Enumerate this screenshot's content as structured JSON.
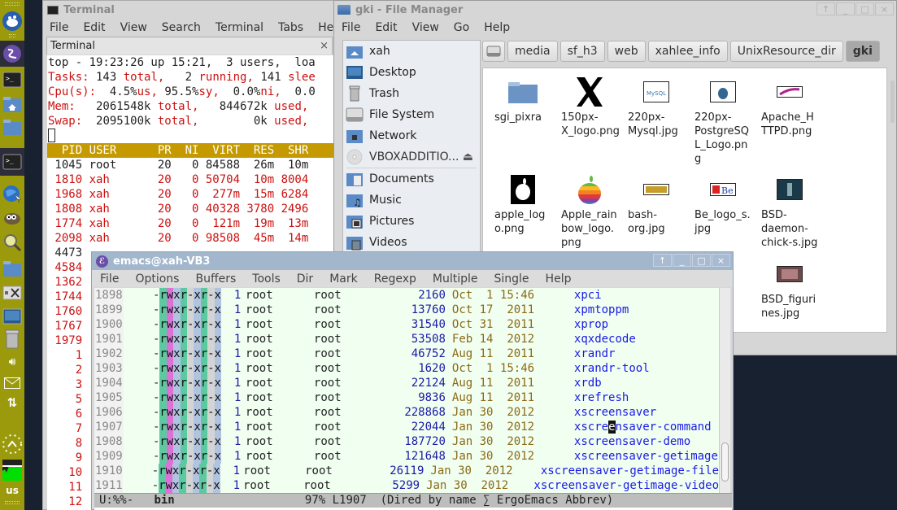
{
  "dock": {
    "icons": [
      "xfce-logo-icon",
      "emacs-icon",
      "terminal-icon",
      "home-folder-icon",
      "folder-icon",
      "terminal-icon",
      "web-browser-icon",
      "gimp-icon",
      "search-icon",
      "folder-icon",
      "settings-icon",
      "desktop-icon",
      "trash-icon",
      "volume-icon",
      "mail-icon",
      "network-icon",
      "clock-icon",
      "cpu-graph-icon"
    ],
    "keyboard_layout": "us"
  },
  "terminal": {
    "title": "Terminal",
    "menu": [
      "File",
      "Edit",
      "View",
      "Search",
      "Terminal",
      "Tabs",
      "Help"
    ],
    "tab_label": "Terminal",
    "tab_close": "×",
    "top_header": [
      [
        {
          "t": "top - 19:23:26 up 15:21,  3 users,  loa",
          "c": "k"
        }
      ],
      [
        {
          "t": "Tasks:",
          "c": "r"
        },
        {
          "t": " 143 ",
          "c": "k"
        },
        {
          "t": "total,",
          "c": "r"
        },
        {
          "t": "   2 ",
          "c": "k"
        },
        {
          "t": "running,",
          "c": "r"
        },
        {
          "t": " 141 ",
          "c": "k"
        },
        {
          "t": "slee",
          "c": "r"
        }
      ],
      [
        {
          "t": "Cpu(s):",
          "c": "r"
        },
        {
          "t": "  4.5%",
          "c": "k"
        },
        {
          "t": "us,",
          "c": "r"
        },
        {
          "t": " 95.5%",
          "c": "k"
        },
        {
          "t": "sy,",
          "c": "r"
        },
        {
          "t": "  0.0%",
          "c": "k"
        },
        {
          "t": "ni,",
          "c": "r"
        },
        {
          "t": "  0.0",
          "c": "k"
        }
      ],
      [
        {
          "t": "Mem:",
          "c": "r"
        },
        {
          "t": "   2061548k ",
          "c": "k"
        },
        {
          "t": "total,",
          "c": "r"
        },
        {
          "t": "   844672k ",
          "c": "k"
        },
        {
          "t": "used,",
          "c": "r"
        }
      ],
      [
        {
          "t": "Swap:",
          "c": "r"
        },
        {
          "t": "  2095100k ",
          "c": "k"
        },
        {
          "t": "total,",
          "c": "r"
        },
        {
          "t": "        0k ",
          "c": "k"
        },
        {
          "t": "used,",
          "c": "r"
        }
      ]
    ],
    "table_header": "  PID USER      PR  NI  VIRT  RES  SHR",
    "processes": [
      {
        "text": " 1045 root      20   0 84588  26m  10m",
        "highlight": false
      },
      {
        "text": " 1810 xah       20   0 50704  10m 8004",
        "highlight": true
      },
      {
        "text": " 1968 xah       20   0  277m  15m 6284",
        "highlight": true
      },
      {
        "text": " 1808 xah       20   0 40328 3780 2496",
        "highlight": true
      },
      {
        "text": " 1774 xah       20   0  121m  19m  13m",
        "highlight": true
      },
      {
        "text": " 2098 xah       20   0 98508  45m  14m",
        "highlight": true
      },
      {
        "text": " 4473",
        "highlight": false
      },
      {
        "text": " 4584",
        "highlight": true
      },
      {
        "text": " 1362",
        "highlight": true
      },
      {
        "text": " 1744",
        "highlight": true
      },
      {
        "text": " 1760",
        "highlight": true
      },
      {
        "text": " 1767",
        "highlight": true
      },
      {
        "text": " 1979",
        "highlight": true
      },
      {
        "text": "    1",
        "highlight": true
      },
      {
        "text": "    2",
        "highlight": true
      },
      {
        "text": "    3",
        "highlight": true
      },
      {
        "text": "    5",
        "highlight": true
      },
      {
        "text": "    6",
        "highlight": true
      },
      {
        "text": "    7",
        "highlight": true
      },
      {
        "text": "    8",
        "highlight": true
      },
      {
        "text": "    9",
        "highlight": true
      },
      {
        "text": "   10",
        "highlight": true
      },
      {
        "text": "   11",
        "highlight": true
      },
      {
        "text": "   12",
        "highlight": true
      }
    ]
  },
  "file_manager": {
    "title": "gki - File Manager",
    "menu": [
      "File",
      "Edit",
      "View",
      "Go",
      "Help"
    ],
    "window_buttons": [
      "↑",
      "_",
      "□",
      "×"
    ],
    "places": [
      {
        "label": "xah",
        "icon": "home-icon"
      },
      {
        "label": "Desktop",
        "icon": "desktop-icon"
      },
      {
        "label": "Trash",
        "icon": "trash-icon"
      },
      {
        "label": "File System",
        "icon": "drive-icon"
      },
      {
        "label": "Network",
        "icon": "network-icon"
      },
      {
        "label": "VBOXADDITIO...",
        "icon": "cdrom-icon",
        "eject": "⏏"
      },
      {
        "label": "Documents",
        "icon": "documents-folder-icon"
      },
      {
        "label": "Music",
        "icon": "music-folder-icon"
      },
      {
        "label": "Pictures",
        "icon": "pictures-folder-icon"
      },
      {
        "label": "Videos",
        "icon": "videos-folder-icon"
      }
    ],
    "path": [
      "media",
      "sf_h3",
      "web",
      "xahlee_info",
      "UnixResource_dir",
      "gki"
    ],
    "files": [
      {
        "name": "sgi_pixra",
        "kind": "folder"
      },
      {
        "name": "150px-\nX_logo.png",
        "kind": "x-logo"
      },
      {
        "name": "220px-\nMysql.jpg",
        "kind": "mysql"
      },
      {
        "name": "220px-\nPostgreSQ\nL_Logo.pn\ng",
        "kind": "postgres"
      },
      {
        "name": "Apache_H\nTTPD.png",
        "kind": "apache"
      },
      {
        "name": "apple_log\no.png",
        "kind": "apple"
      },
      {
        "name": "Apple_rain\nbow_logo.\npng",
        "kind": "apple-rainbow"
      },
      {
        "name": "bash-\norg.jpg",
        "kind": "bash"
      },
      {
        "name": "Be_logo_s.\njpg",
        "kind": "be"
      },
      {
        "name": "BSD-\ndaemon-\nchick-s.jpg",
        "kind": "bsd"
      },
      {
        "name": "BSD_figuri\nnes.jpg",
        "kind": "bsd-fig"
      }
    ]
  },
  "emacs": {
    "title": "emacs@xah-VB3",
    "menu": [
      "File",
      "Options",
      "Buffers",
      "Tools",
      "Dir",
      "Mark",
      "Regexp",
      "Multiple",
      "Single",
      "Help"
    ],
    "window_buttons": [
      "↑",
      "_",
      "□",
      "×"
    ],
    "perm": "-rwxr-xr-x",
    "rows": [
      {
        "ln": "1898",
        "links": "1",
        "owner": "root",
        "group": "root",
        "size": "2160",
        "date": "Oct  1 15:46",
        "name": "xpci"
      },
      {
        "ln": "1899",
        "links": "1",
        "owner": "root",
        "group": "root",
        "size": "13760",
        "date": "Oct 17  2011",
        "name": "xpmtoppm"
      },
      {
        "ln": "1900",
        "links": "1",
        "owner": "root",
        "group": "root",
        "size": "31540",
        "date": "Oct 31  2011",
        "name": "xprop"
      },
      {
        "ln": "1901",
        "links": "1",
        "owner": "root",
        "group": "root",
        "size": "53508",
        "date": "Feb 14  2012",
        "name": "xqxdecode"
      },
      {
        "ln": "1902",
        "links": "1",
        "owner": "root",
        "group": "root",
        "size": "46752",
        "date": "Aug 11  2011",
        "name": "xrandr"
      },
      {
        "ln": "1903",
        "links": "1",
        "owner": "root",
        "group": "root",
        "size": "1620",
        "date": "Oct  1 15:46",
        "name": "xrandr-tool"
      },
      {
        "ln": "1904",
        "links": "1",
        "owner": "root",
        "group": "root",
        "size": "22124",
        "date": "Aug 11  2011",
        "name": "xrdb"
      },
      {
        "ln": "1905",
        "links": "1",
        "owner": "root",
        "group": "root",
        "size": "9836",
        "date": "Aug 11  2011",
        "name": "xrefresh"
      },
      {
        "ln": "1906",
        "links": "1",
        "owner": "root",
        "group": "root",
        "size": "228868",
        "date": "Jan 30  2012",
        "name": "xscreensaver"
      },
      {
        "ln": "1907",
        "links": "1",
        "owner": "root",
        "group": "root",
        "size": "22044",
        "date": "Jan 30  2012",
        "name": "xscreensaver-command",
        "cursor_at": 5
      },
      {
        "ln": "1908",
        "links": "1",
        "owner": "root",
        "group": "root",
        "size": "187720",
        "date": "Jan 30  2012",
        "name": "xscreensaver-demo"
      },
      {
        "ln": "1909",
        "links": "1",
        "owner": "root",
        "group": "root",
        "size": "121648",
        "date": "Jan 30  2012",
        "name": "xscreensaver-getimage"
      },
      {
        "ln": "1910",
        "links": "1",
        "owner": "root",
        "group": "root",
        "size": "26119",
        "date": "Jan 30  2012",
        "name": "xscreensaver-getimage-file"
      },
      {
        "ln": "1911",
        "links": "1",
        "owner": "root",
        "group": "root",
        "size": "5299",
        "date": "Jan 30  2012",
        "name": "xscreensaver-getimage-video"
      }
    ],
    "modeline": {
      "status": "U:%%-",
      "buffer": "bin",
      "position": "97% L1907",
      "modes": "(Dired by name ∑ ErgoEmacs Abbrev)"
    }
  }
}
